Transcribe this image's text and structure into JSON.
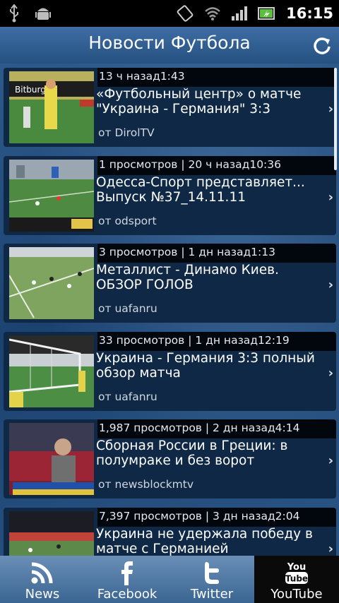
{
  "status": {
    "time": "16:15"
  },
  "header": {
    "title": "Новости Футбола"
  },
  "videos": [
    {
      "meta": "13 ч назад1:43",
      "title": "«Футбольный центр» о матче \"Украина - Германия\" 3:3",
      "source": "от DirolTV"
    },
    {
      "meta": "1 просмотров | 20 ч назад10:36",
      "title": "Одесса-Спорт представляет... Выпуск №37_14.11.11",
      "source": "от odsport"
    },
    {
      "meta": "3 просмотров | 1 дн назад1:13",
      "title": "Металлист - Динамо Киев. ОБЗОР ГОЛОВ",
      "source": "от uafanru"
    },
    {
      "meta": "33 просмотров | 1 дн назад12:19",
      "title": "Украина - Германия 3:3 полный обзор матча",
      "source": "от uafanru"
    },
    {
      "meta": "1,987 просмотров | 2 дн назад4:14",
      "title": "Сборная России в Греции: в полумраке и без ворот",
      "source": "от newsblockmtv"
    },
    {
      "meta": "7,397 просмотров | 3 дн назад2:04",
      "title": "Украина не удержала победу в матче с Германией",
      "source": ""
    }
  ],
  "tabs": [
    {
      "label": "News",
      "icon": "rss-icon"
    },
    {
      "label": "Facebook",
      "icon": "facebook-icon"
    },
    {
      "label": "Twitter",
      "icon": "twitter-icon"
    },
    {
      "label": "YouTube",
      "icon": "youtube-icon",
      "icon_text_top": "You",
      "icon_text_bottom": "Tube"
    }
  ]
}
